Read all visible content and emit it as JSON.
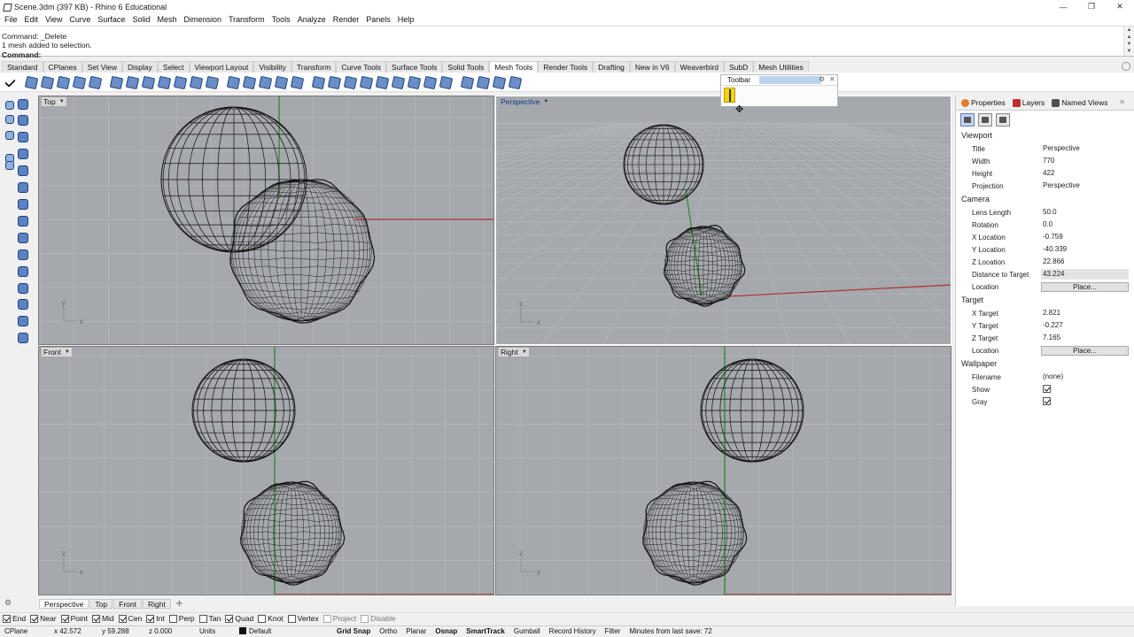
{
  "window": {
    "title": "Scene.3dm (397 KB) - Rhino 6 Educational",
    "controls": [
      "—",
      "❐",
      "✕"
    ]
  },
  "menu": [
    "File",
    "Edit",
    "View",
    "Curve",
    "Surface",
    "Solid",
    "Mesh",
    "Dimension",
    "Transform",
    "Tools",
    "Analyze",
    "Render",
    "Panels",
    "Help"
  ],
  "command": {
    "history": [
      "Command: _Delete",
      "1 mesh added to selection."
    ],
    "prompt": "Command:"
  },
  "toolbar_tabs": [
    "Standard",
    "CPlanes",
    "Set View",
    "Display",
    "Select",
    "Viewport Layout",
    "Visibility",
    "Transform",
    "Curve Tools",
    "Surface Tools",
    "Solid Tools",
    "Mesh Tools",
    "Render Tools",
    "Drafting",
    "New in V6",
    "Weaverbird",
    "SubD",
    "Mesh Utilities"
  ],
  "active_toolbar_tab": "Mesh Tools",
  "floating_toolbar": {
    "title": "Toolbar"
  },
  "viewports": {
    "top": {
      "label": "Top"
    },
    "perspective": {
      "label": "Perspective"
    },
    "front": {
      "label": "Front"
    },
    "right": {
      "label": "Right"
    }
  },
  "viewport_tabs": [
    "Perspective",
    "Top",
    "Front",
    "Right"
  ],
  "panel": {
    "tabs": [
      "Properties",
      "Layers",
      "Named Views"
    ],
    "sections": {
      "viewport": "Viewport",
      "camera": "Camera",
      "target": "Target",
      "wallpaper": "Wallpaper"
    },
    "viewport_rows": [
      {
        "key": "Title",
        "value": "Perspective"
      },
      {
        "key": "Width",
        "value": "770"
      },
      {
        "key": "Height",
        "value": "422"
      },
      {
        "key": "Projection",
        "value": "Perspective"
      }
    ],
    "camera_rows": [
      {
        "key": "Lens Length",
        "value": "50.0"
      },
      {
        "key": "Rotation",
        "value": "0.0"
      },
      {
        "key": "X Location",
        "value": "-0.759"
      },
      {
        "key": "Y Location",
        "value": "-40.339"
      },
      {
        "key": "Z Location",
        "value": "22.866"
      },
      {
        "key": "Distance to Target",
        "value": "43.224"
      },
      {
        "key": "Location",
        "value": "Place..."
      }
    ],
    "target_rows": [
      {
        "key": "X Target",
        "value": "2.821"
      },
      {
        "key": "Y Target",
        "value": "-0.227"
      },
      {
        "key": "Z Target",
        "value": "7.165"
      },
      {
        "key": "Location",
        "value": "Place..."
      }
    ],
    "wallpaper_rows": [
      {
        "key": "Filename",
        "value": "(none)"
      },
      {
        "key": "Show",
        "value": ""
      },
      {
        "key": "Gray",
        "value": ""
      }
    ]
  },
  "osnaps": [
    {
      "label": "End",
      "checked": true
    },
    {
      "label": "Near",
      "checked": true
    },
    {
      "label": "Point",
      "checked": true
    },
    {
      "label": "Mid",
      "checked": true
    },
    {
      "label": "Cen",
      "checked": true
    },
    {
      "label": "Int",
      "checked": true
    },
    {
      "label": "Perp",
      "checked": false
    },
    {
      "label": "Tan",
      "checked": false
    },
    {
      "label": "Quad",
      "checked": true
    },
    {
      "label": "Knot",
      "checked": false
    },
    {
      "label": "Vertex",
      "checked": false
    },
    {
      "label": "Project",
      "checked": false
    },
    {
      "label": "Disable",
      "checked": false
    }
  ],
  "status": {
    "cplane": "CPlane",
    "x": "x 42.572",
    "y": "y 59.288",
    "z": "z 0.000",
    "units": "Units",
    "layer": "Default",
    "grid_snap": "Grid Snap",
    "ortho": "Ortho",
    "planar": "Planar",
    "osnap": "Osnap",
    "smarttrack": "SmartTrack",
    "gumball": "Gumball",
    "record_history": "Record History",
    "filter": "Filter",
    "save_info": "Minutes from last save: 72"
  },
  "axis_labels": {
    "x": "x",
    "y": "y",
    "z": "z"
  },
  "colors": {
    "viewport_bg": "#a5a8ad",
    "grid": "#b4b7bc",
    "x_axis": "#b03030",
    "y_axis": "#2a8a2a",
    "selection_tab": "#0b3e8a"
  }
}
